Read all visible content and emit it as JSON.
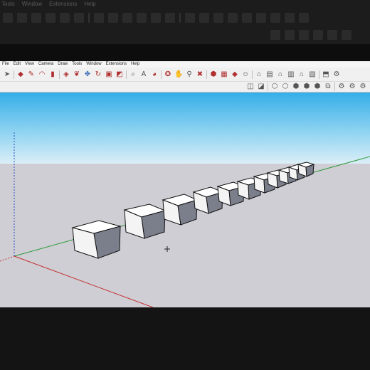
{
  "background_app": {
    "menu": [
      "Tools",
      "Window",
      "Extensions",
      "Help"
    ]
  },
  "app": {
    "menu": [
      "File",
      "Edit",
      "View",
      "Camera",
      "Draw",
      "Tools",
      "Window",
      "Extensions",
      "Help"
    ],
    "toolbar_icons": [
      "select-icon",
      "eraser-icon",
      "pencil-icon",
      "arc-icon",
      "shape-icon",
      "push-pull-icon",
      "follow-me-icon",
      "move-icon",
      "rotate-icon",
      "scale-icon",
      "offset-icon",
      "tape-measure-icon",
      "text-icon",
      "paint-bucket-icon",
      "orbit-icon",
      "pan-icon",
      "zoom-icon",
      "zoom-extents-icon",
      "warehouse-icon",
      "extension-warehouse-icon",
      "ruby-icon",
      "account-icon",
      "iso-view-icon",
      "top-view-icon",
      "front-view-icon",
      "right-view-icon",
      "back-view-icon",
      "left-view-icon",
      "camera-icon",
      "settings-icon"
    ],
    "style_icons": [
      "xray-icon",
      "back-edges-icon",
      "wireframe-icon",
      "hidden-line-icon",
      "shaded-icon",
      "textures-icon",
      "monochrome-icon",
      "section-icon",
      "gear-icon"
    ]
  },
  "scene": {
    "sky_colors": [
      "#35aee8",
      "#dbeef7"
    ],
    "ground_color": "#cfced4",
    "box_count": 11
  }
}
